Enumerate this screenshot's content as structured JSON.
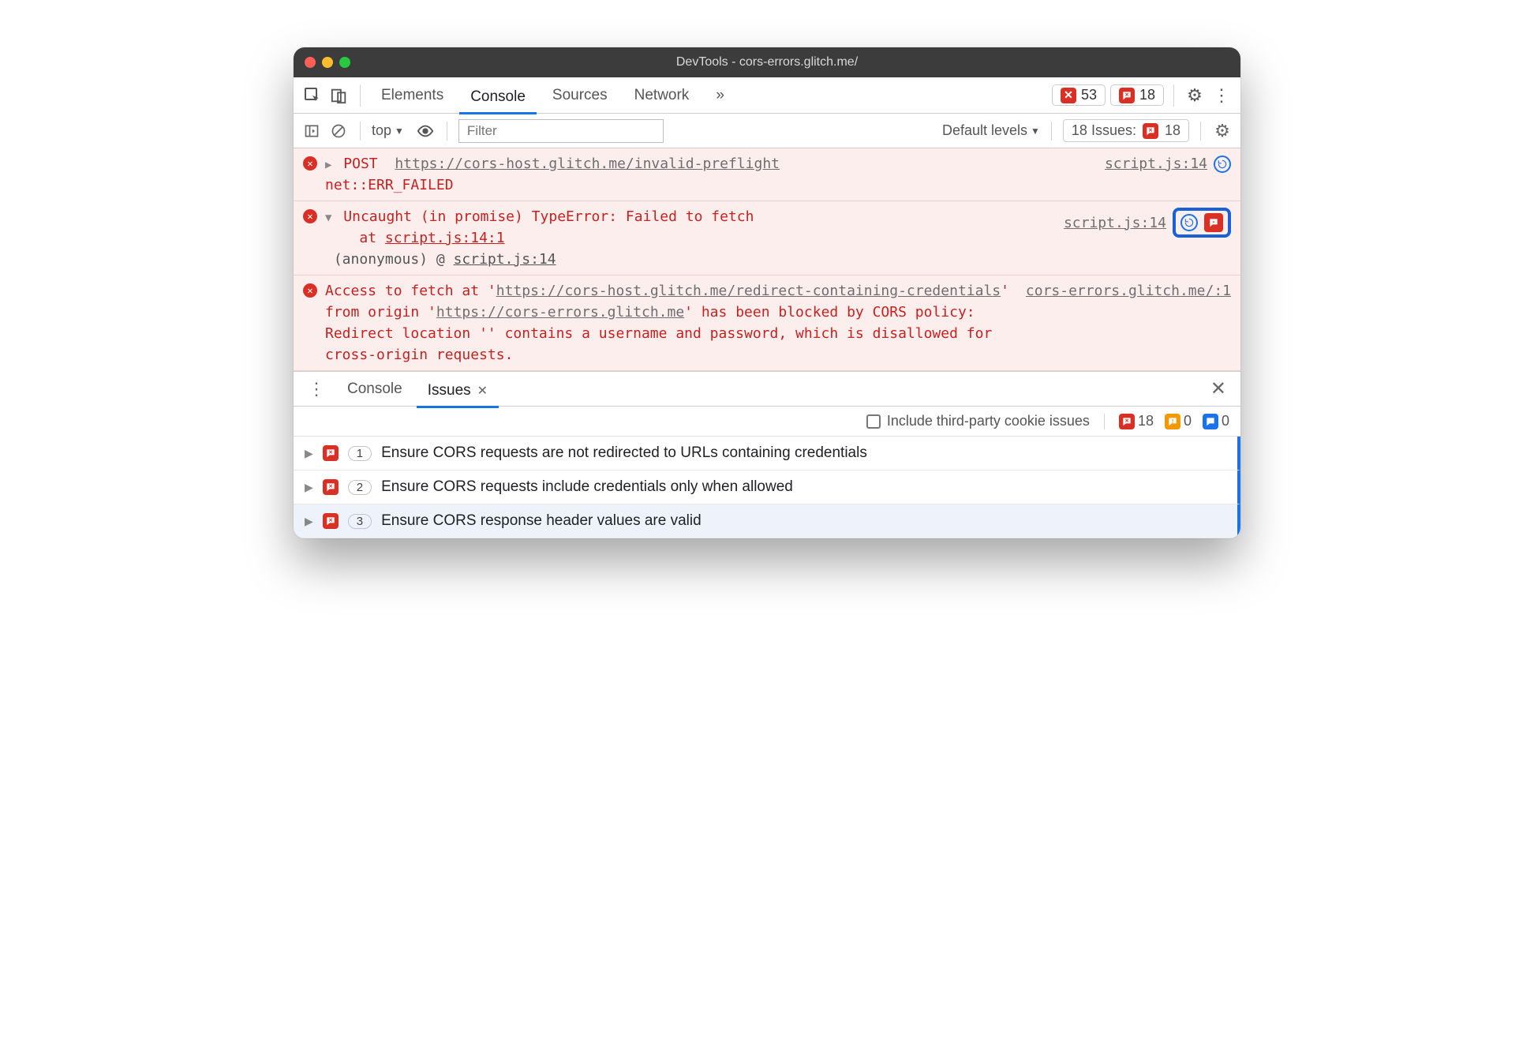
{
  "window": {
    "title": "DevTools - cors-errors.glitch.me/"
  },
  "tabs": {
    "elements": "Elements",
    "console": "Console",
    "sources": "Sources",
    "network": "Network",
    "more": "»"
  },
  "tabbar_badges": {
    "errors": "53",
    "issues": "18"
  },
  "consolebar": {
    "context": "top",
    "filter_placeholder": "Filter",
    "levels": "Default levels",
    "issues_label": "18 Issues:",
    "issues_count": "18"
  },
  "log": {
    "row1": {
      "method": "POST",
      "url": "https://cors-host.glitch.me/invalid-preflight",
      "err": "net::ERR_FAILED",
      "source": "script.js:14"
    },
    "row2": {
      "msg": "Uncaught (in promise) TypeError: Failed to fetch",
      "at": "at ",
      "at_link": "script.js:14:1",
      "anon": "(anonymous) @",
      "anon_link": "script.js:14",
      "source": "script.js:14"
    },
    "row3": {
      "pre1": "Access to fetch at '",
      "url1a": "https://cors-host.glitch.me/redi",
      "url1b": "rect-containing-credentials",
      "mid": "' from origin '",
      "url2": "https://cors-errors.glitch.me",
      "tail": "' has been blocked by CORS policy: Redirect location '' contains a username and password, which is disallowed for cross-origin requests.",
      "source": "cors-errors.glitch.me/:1"
    }
  },
  "drawer": {
    "tab_console": "Console",
    "tab_issues": "Issues",
    "filter_label": "Include third-party cookie issues",
    "counts": {
      "errors": "18",
      "warnings": "0",
      "info": "0"
    }
  },
  "issues": [
    {
      "count": "1",
      "title": "Ensure CORS requests are not redirected to URLs containing credentials"
    },
    {
      "count": "2",
      "title": "Ensure CORS requests include credentials only when allowed"
    },
    {
      "count": "3",
      "title": "Ensure CORS response header values are valid"
    }
  ]
}
